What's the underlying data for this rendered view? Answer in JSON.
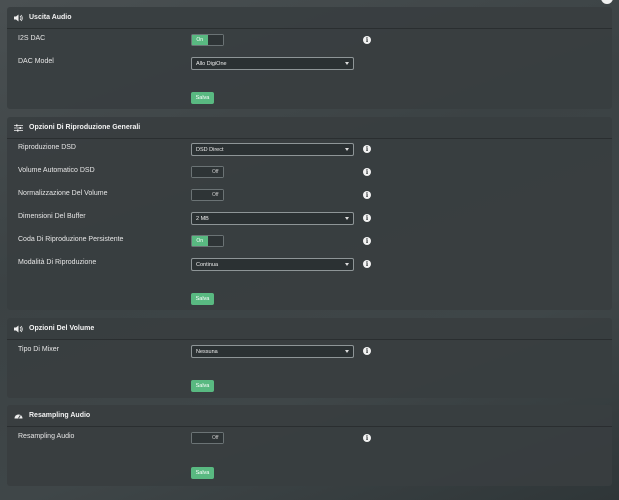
{
  "sections": {
    "audio_output": {
      "title": "Uscita Audio",
      "icon": "speaker-icon",
      "i2s_dac": {
        "label": "I2S DAC",
        "state": "On"
      },
      "dac_model": {
        "label": "DAC Model",
        "value": "Allo DigiOne"
      },
      "save_label": "Salva"
    },
    "playback_general": {
      "title": "Opzioni Di Riproduzione Generali",
      "icon": "sliders-icon",
      "dsd_playback": {
        "label": "Riproduzione DSD",
        "value": "DSD Direct"
      },
      "dsd_auto_volume": {
        "label": "Volume Automatico DSD",
        "state": "Off"
      },
      "volume_normalization": {
        "label": "Normalizzazione Del Volume",
        "state": "Off"
      },
      "buffer_size": {
        "label": "Dimensioni Del Buffer",
        "value": "2 MB"
      },
      "persistent_queue": {
        "label": "Coda Di Riproduzione Persistente",
        "state": "On"
      },
      "playback_mode": {
        "label": "Modalità Di Riproduzione",
        "value": "Continua"
      },
      "save_label": "Salva"
    },
    "volume_options": {
      "title": "Opzioni Del Volume",
      "icon": "speaker-icon",
      "mixer_type": {
        "label": "Tipo Di Mixer",
        "value": "Nessuna"
      },
      "save_label": "Salva"
    },
    "resampling": {
      "title": "Resampling Audio",
      "icon": "gauge-icon",
      "resampling_audio": {
        "label": "Resampling Audio",
        "state": "Off"
      },
      "save_label": "Salva"
    }
  },
  "colors": {
    "accent": "#59b981",
    "panel": "#383e40",
    "text": "#e6e6e6"
  }
}
